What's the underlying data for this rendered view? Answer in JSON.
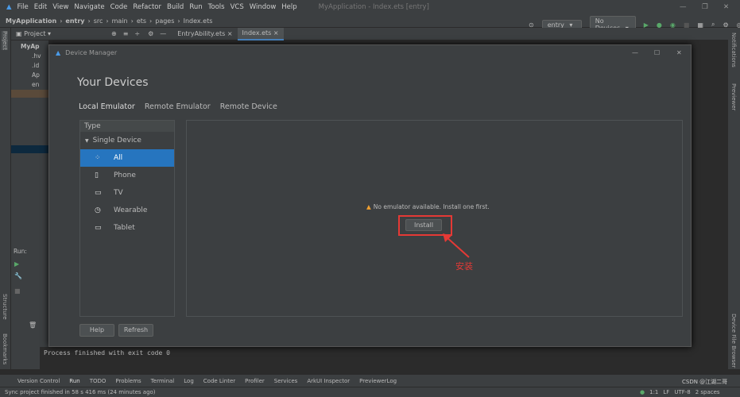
{
  "menu": {
    "items": [
      "File",
      "Edit",
      "View",
      "Navigate",
      "Code",
      "Refactor",
      "Build",
      "Run",
      "Tools",
      "VCS",
      "Window",
      "Help"
    ],
    "window_title": "MyApplication - Index.ets [entry]"
  },
  "breadcrumb": [
    "MyApplication",
    "entry",
    "src",
    "main",
    "ets",
    "pages",
    "Index.ets"
  ],
  "toolbar": {
    "module": "entry",
    "device": "No Devices"
  },
  "project_panel": {
    "label": "Project",
    "tree": [
      "MyAp",
      ".hv",
      ".id",
      "Ap",
      "en"
    ]
  },
  "editor_tabs": [
    "EntryAbility.ets",
    "Index.ets"
  ],
  "side_left": [
    "Project",
    "Structure",
    "Bookmarks"
  ],
  "side_right": [
    "Notifications",
    "Previewer",
    "Device File Browser"
  ],
  "run_label": "Run:",
  "dialog": {
    "title": "Device Manager",
    "heading": "Your Devices",
    "tabs": [
      "Local Emulator",
      "Remote Emulator",
      "Remote Device"
    ],
    "type_header": "Type",
    "group": "Single Device",
    "types": [
      {
        "icon": "all-icon",
        "label": "All"
      },
      {
        "icon": "phone-icon",
        "label": "Phone"
      },
      {
        "icon": "tv-icon",
        "label": "TV"
      },
      {
        "icon": "watch-icon",
        "label": "Wearable"
      },
      {
        "icon": "tablet-icon",
        "label": "Tablet"
      }
    ],
    "message": "No emulator available. Install one first.",
    "install": "Install",
    "annotation": "安装",
    "help": "Help",
    "refresh": "Refresh"
  },
  "console_text": "Process finished with exit code 0",
  "bottom_tabs": [
    "Version Control",
    "Run",
    "TODO",
    "Problems",
    "Terminal",
    "Log",
    "Code Linter",
    "Profiler",
    "Services",
    "ArkUI Inspector",
    "PreviewerLog"
  ],
  "status": {
    "message": "Sync project finished in 58 s 416 ms (24 minutes ago)",
    "position": "1:1",
    "line_sep": "LF",
    "encoding": "UTF-8",
    "indent": "2 spaces",
    "watermark": "CSDN @江湖二哥"
  },
  "colors": {
    "accent": "#2675bf",
    "annotation": "#e53935"
  }
}
